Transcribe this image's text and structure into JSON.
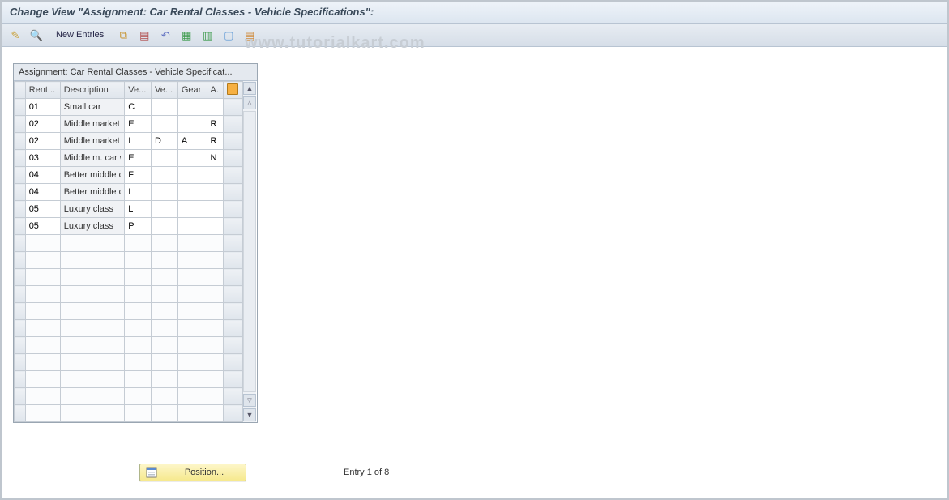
{
  "header": {
    "title": "Change View \"Assignment: Car Rental Classes - Vehicle Specifications\":"
  },
  "toolbar": {
    "new_entries": "New Entries"
  },
  "watermark": "www.tutorialkart.com",
  "grid": {
    "caption": "Assignment: Car Rental Classes - Vehicle Specificat...",
    "columns": [
      "Rent...",
      "Description",
      "Ve...",
      "Ve...",
      "Gear",
      "A."
    ],
    "total_visible_rows": 19,
    "rows": [
      {
        "rent": "01",
        "desc": "Small car",
        "v1": "C",
        "v2": "",
        "gear": "",
        "a": ""
      },
      {
        "rent": "02",
        "desc": "Middle market car …",
        "v1": "E",
        "v2": "",
        "gear": "",
        "a": "R"
      },
      {
        "rent": "02",
        "desc": "Middle market car …",
        "v1": "I",
        "v2": "D",
        "gear": "A",
        "a": "R"
      },
      {
        "rent": "03",
        "desc": "Middle m. car with…",
        "v1": "E",
        "v2": "",
        "gear": "",
        "a": "N"
      },
      {
        "rent": "04",
        "desc": "Better middle class",
        "v1": "F",
        "v2": "",
        "gear": "",
        "a": ""
      },
      {
        "rent": "04",
        "desc": "Better middle class",
        "v1": "I",
        "v2": "",
        "gear": "",
        "a": ""
      },
      {
        "rent": "05",
        "desc": "Luxury class",
        "v1": "L",
        "v2": "",
        "gear": "",
        "a": ""
      },
      {
        "rent": "05",
        "desc": "Luxury class",
        "v1": "P",
        "v2": "",
        "gear": "",
        "a": ""
      }
    ]
  },
  "footer": {
    "position_label": "Position...",
    "entry_text": "Entry 1 of 8"
  }
}
